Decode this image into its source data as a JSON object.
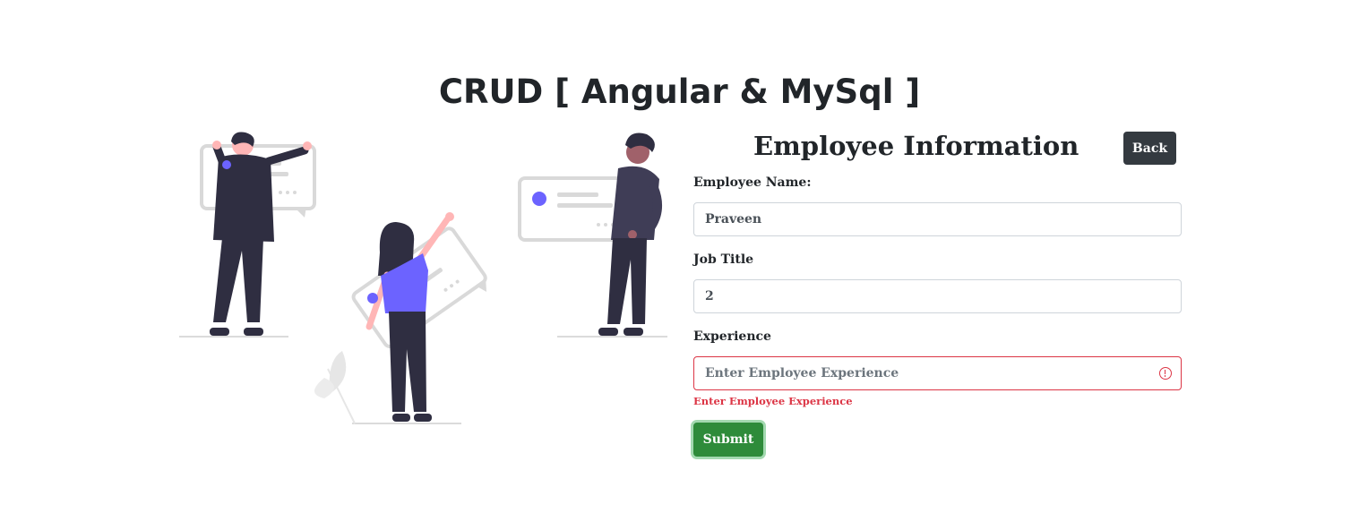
{
  "app": {
    "title": "CRUD [ Angular & MySql ]"
  },
  "form": {
    "heading": "Employee Information",
    "back_label": "Back",
    "fields": [
      {
        "label": "Employee Name:",
        "value": "Praveen",
        "placeholder": ""
      },
      {
        "label": "Job Title",
        "value": "2",
        "placeholder": ""
      },
      {
        "label": "Experience",
        "value": "",
        "placeholder": "Enter Employee Experience",
        "error": "Enter Employee Experience"
      }
    ],
    "submit_label": "Submit"
  },
  "colors": {
    "accent_purple": "#6c63ff",
    "figure_dark": "#2f2e41",
    "skin_pink": "#ffb6b6",
    "card_gray": "#e6e6e6",
    "submit_green": "#2e8b3a",
    "error_red": "#dc3545",
    "back_button": "#343a40"
  },
  "illustration": {
    "name": "team-collaboration-illustration"
  }
}
